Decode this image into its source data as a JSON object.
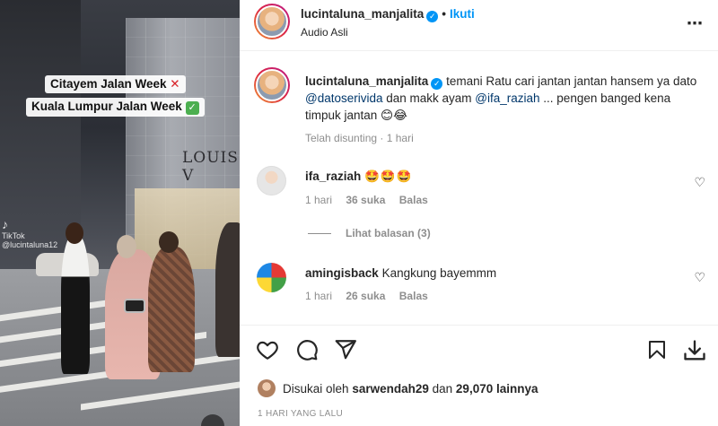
{
  "video": {
    "caption_line1": "Citayem Jalan Week",
    "caption_line1_emoji": "✕",
    "caption_line2": "Kuala Lumpur Jalan Week",
    "caption_line2_emoji": "✓",
    "storefront_sign": "LOUIS V",
    "watermark_app": "TikTok",
    "watermark_user": "@lucintaluna12"
  },
  "header": {
    "username": "lucintaluna_manjalita",
    "verified_icon": "verified-badge-icon",
    "follow_label": "Ikuti",
    "audio_label": "Audio Asli",
    "more_icon": "more-options-icon"
  },
  "caption": {
    "username": "lucintaluna_manjalita",
    "text_part1": "temani Ratu cari jantan jantan hansem ya dato ",
    "mention1": "@datoserivida",
    "text_part2": " dan makk ayam ",
    "mention2": "@ifa_raziah",
    "text_part3": " ... pengen banged kena timpuk jantan 😊😂",
    "edited_label": "Telah disunting",
    "time": "1 hari"
  },
  "comments": [
    {
      "username": "ifa_raziah",
      "text": "🤩🤩🤩",
      "time": "1 hari",
      "likes": "36 suka",
      "reply_label": "Balas",
      "view_replies": "Lihat balasan (3)"
    },
    {
      "username": "amingisback",
      "text": "Kangkung bayemmm",
      "time": "1 hari",
      "likes": "26 suka",
      "reply_label": "Balas"
    }
  ],
  "actions": {
    "like_icon": "heart-icon",
    "comment_icon": "comment-icon",
    "share_icon": "share-icon",
    "save_icon": "bookmark-icon",
    "download_icon": "download-icon"
  },
  "likes": {
    "prefix": "Disukai oleh",
    "user": "sarwendah29",
    "connector": "dan",
    "count": "29,070 lainnya"
  },
  "timestamp": "1 HARI YANG LALU"
}
